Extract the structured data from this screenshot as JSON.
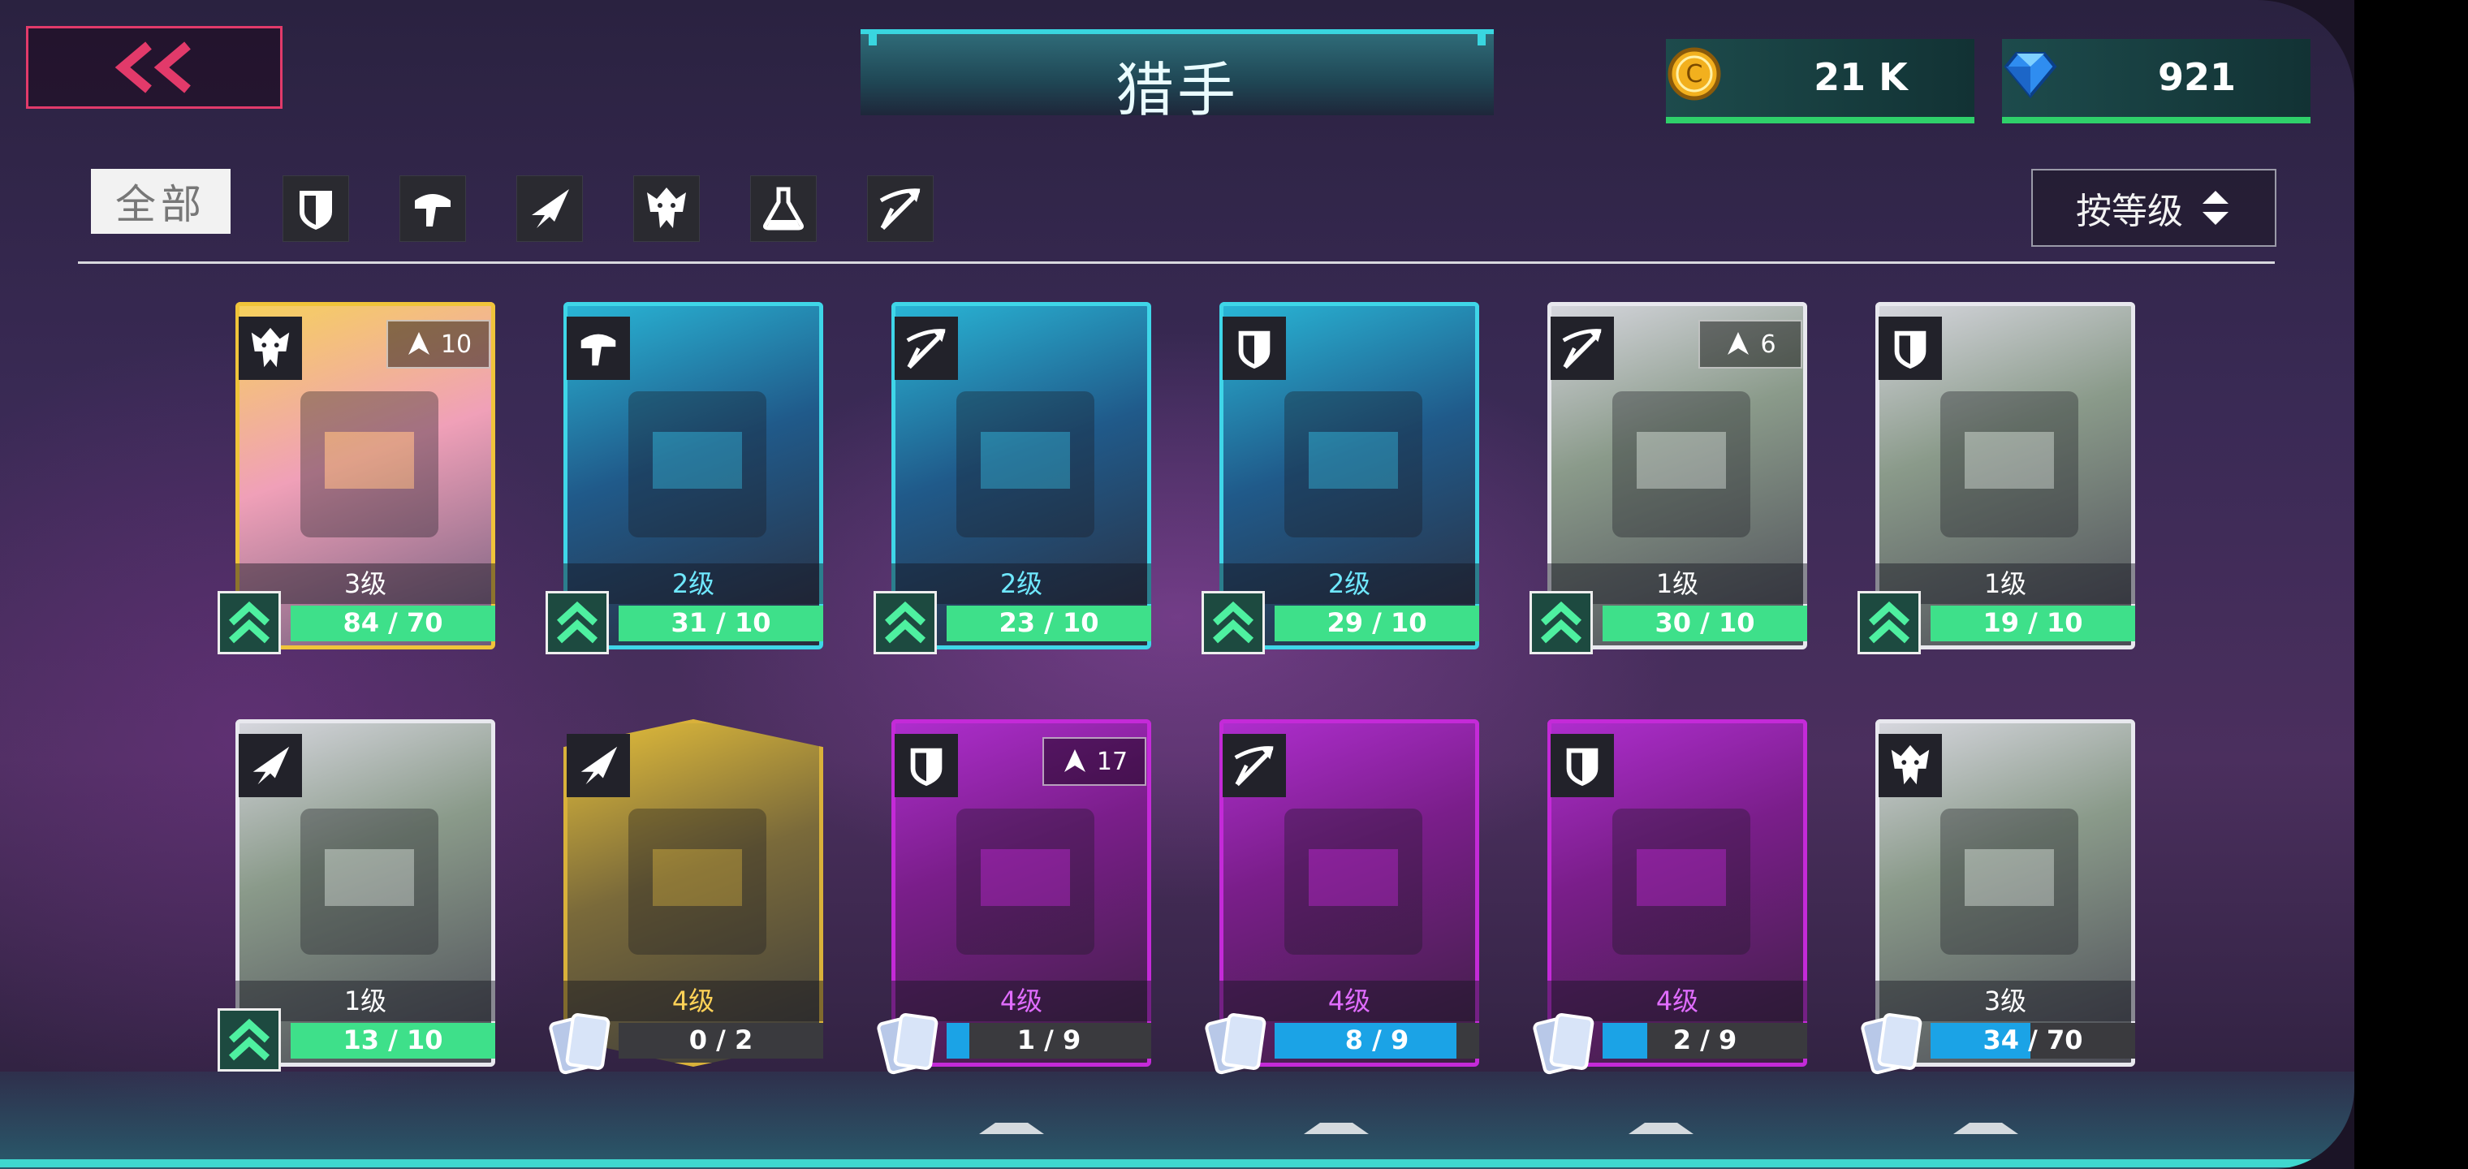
{
  "header": {
    "title": "猎手",
    "coins": "21 K",
    "gems": "921"
  },
  "filters": {
    "all_label": "全部",
    "classes": [
      "shield-icon",
      "helmet-icon",
      "paper-plane-icon",
      "spiky-mask-icon",
      "flask-icon",
      "crossbow-icon"
    ]
  },
  "sort": {
    "label": "按等级"
  },
  "colors": {
    "accent_cyan": "#39d6e0",
    "accent_green": "#2fd06a",
    "back_border": "#e23a6a",
    "bar_blue": "#1ba3e6"
  },
  "cards": [
    {
      "class": "spiky-mask-icon",
      "level": "3级",
      "progress": "84 / 70",
      "shards": "10",
      "upgradable": true,
      "frame": "gold",
      "fill": 1.0
    },
    {
      "class": "helmet-icon",
      "level": "2级",
      "progress": "31 / 10",
      "shards": "",
      "upgradable": true,
      "frame": "cyan",
      "fill": 1.0
    },
    {
      "class": "crossbow-icon",
      "level": "2级",
      "progress": "23 / 10",
      "shards": "",
      "upgradable": true,
      "frame": "cyan",
      "fill": 1.0
    },
    {
      "class": "shield-icon",
      "level": "2级",
      "progress": "29 / 10",
      "shards": "",
      "upgradable": true,
      "frame": "cyan",
      "fill": 1.0
    },
    {
      "class": "crossbow-icon",
      "level": "1级",
      "progress": "30 / 10",
      "shards": "6",
      "upgradable": true,
      "frame": "white",
      "fill": 1.0
    },
    {
      "class": "shield-icon",
      "level": "1级",
      "progress": "19 / 10",
      "shards": "",
      "upgradable": true,
      "frame": "white",
      "fill": 1.0
    },
    {
      "class": "paper-plane-icon",
      "level": "1级",
      "progress": "13 / 10",
      "shards": "",
      "upgradable": true,
      "frame": "white",
      "fill": 1.0
    },
    {
      "class": "paper-plane-icon",
      "level": "4级",
      "progress": "0 / 2",
      "shards": "",
      "upgradable": false,
      "frame": "goldhex",
      "fill": 0.0
    },
    {
      "class": "shield-icon",
      "level": "4级",
      "progress": "1 / 9",
      "shards": "17",
      "upgradable": false,
      "frame": "purple",
      "fill": 0.11
    },
    {
      "class": "crossbow-icon",
      "level": "4级",
      "progress": "8 / 9",
      "shards": "",
      "upgradable": false,
      "frame": "purple",
      "fill": 0.89
    },
    {
      "class": "shield-icon",
      "level": "4级",
      "progress": "2 / 9",
      "shards": "",
      "upgradable": false,
      "frame": "purple",
      "fill": 0.22
    },
    {
      "class": "spiky-mask-icon",
      "level": "3级",
      "progress": "34 / 70",
      "shards": "",
      "upgradable": false,
      "frame": "white",
      "fill": 0.49
    }
  ]
}
